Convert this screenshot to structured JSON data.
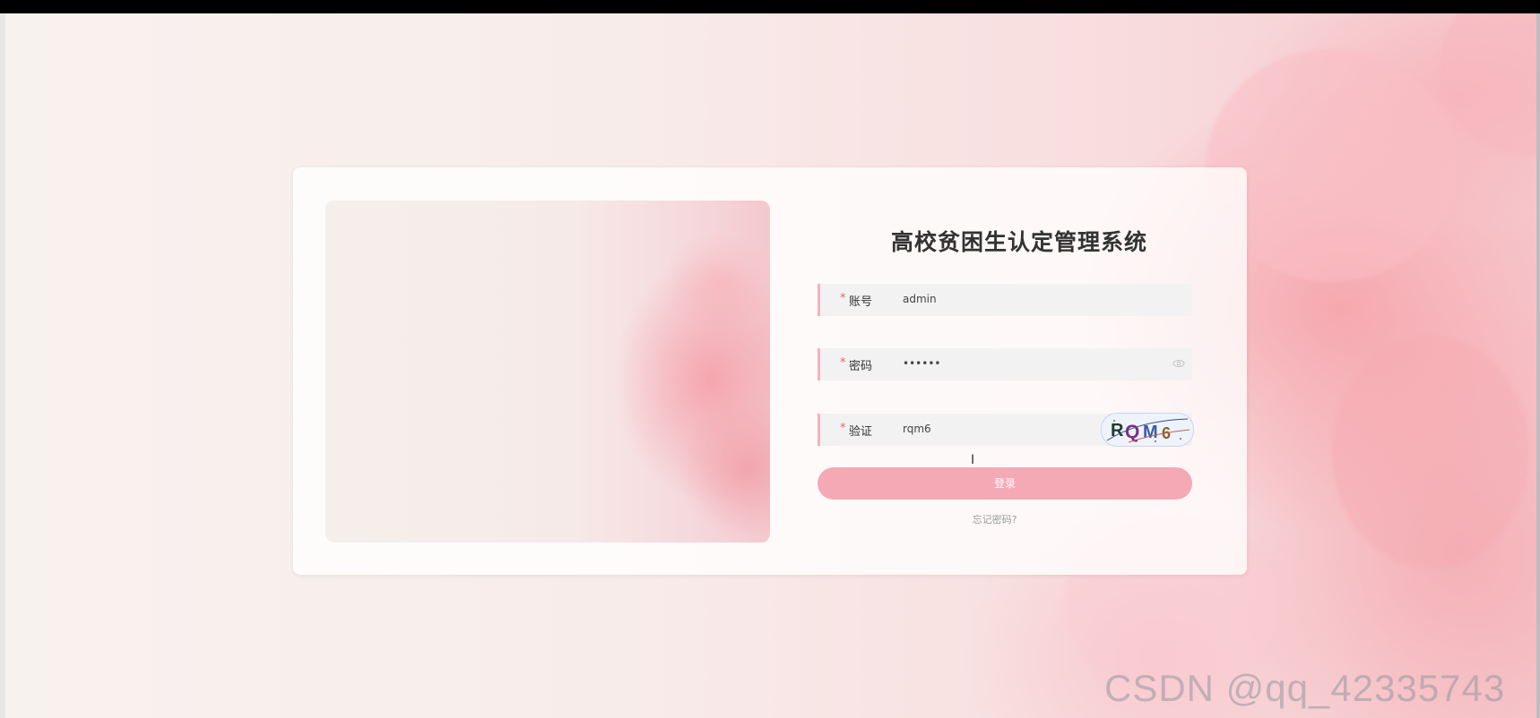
{
  "app": {
    "title": "高校贫困生认定管理系统"
  },
  "login_form": {
    "account": {
      "required_mark": "*",
      "label": "账号",
      "value": "admin"
    },
    "password": {
      "required_mark": "*",
      "label": "密码",
      "value": "••••••"
    },
    "captcha": {
      "required_mark": "*",
      "label": "验证",
      "value": "rqm6",
      "image_text": "RQM6"
    },
    "login_label": "登录",
    "forgot_label": "忘记密码?"
  },
  "watermark": "CSDN @qq_42335743",
  "colors": {
    "accent_pink": "#f5a9b5",
    "required_red": "#e06a6a",
    "field_bg": "#f2f2f2"
  }
}
